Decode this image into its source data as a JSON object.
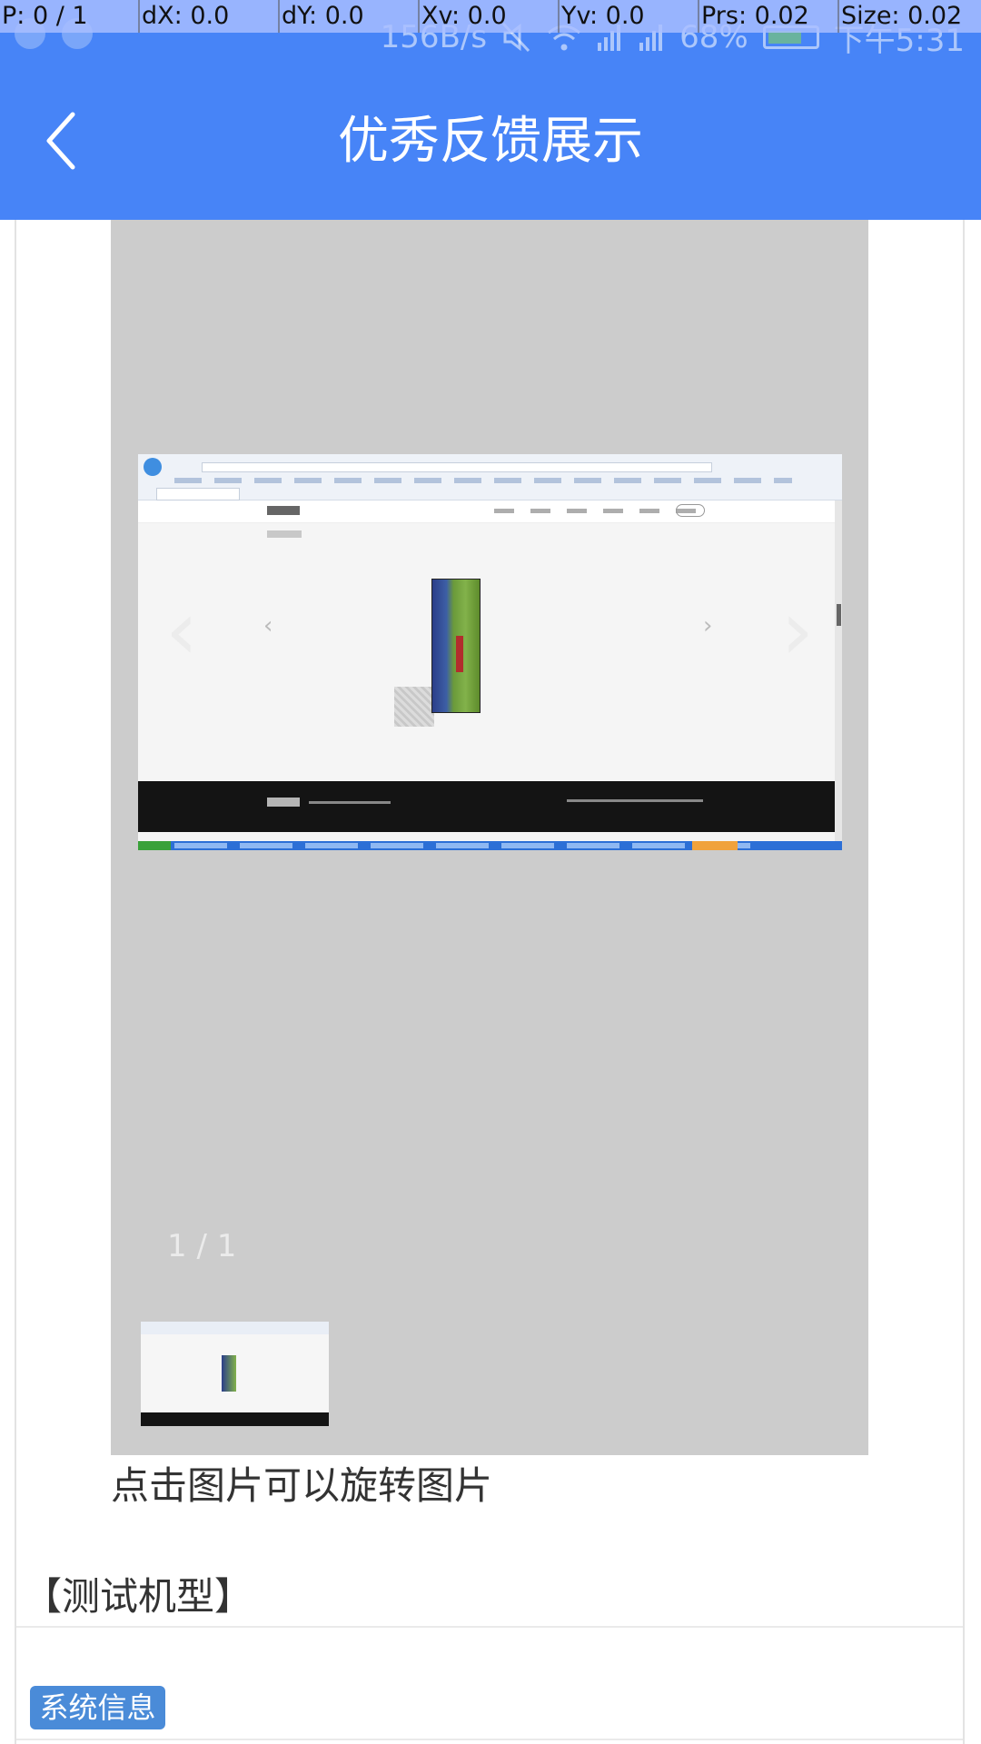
{
  "debug_overlay": {
    "pointer": "P: 0 / 1",
    "dx": "dX: 0.0",
    "dy": "dY: 0.0",
    "xv": "Xv: 0.0",
    "yv": "Yv: 0.0",
    "prs": "Prs: 0.02",
    "size": "Size: 0.02"
  },
  "status_bar": {
    "net_speed": "156B/s",
    "battery_percent": "68%",
    "time": "下午5:31",
    "icons": [
      "mute-icon",
      "wifi-icon",
      "signal-icon",
      "signal-icon",
      "battery-icon"
    ]
  },
  "header": {
    "title": "优秀反馈展示",
    "back_icon": "chevron-left-icon"
  },
  "gallery": {
    "counter": "1 / 1"
  },
  "hint_text": "点击图片可以旋转图片",
  "section_title": "【测试机型】",
  "system_tag": "系统信息",
  "colors": {
    "header_bg": "#4784f7",
    "gallery_bg": "#cccccc",
    "tag_bg": "#4a8bd8"
  }
}
